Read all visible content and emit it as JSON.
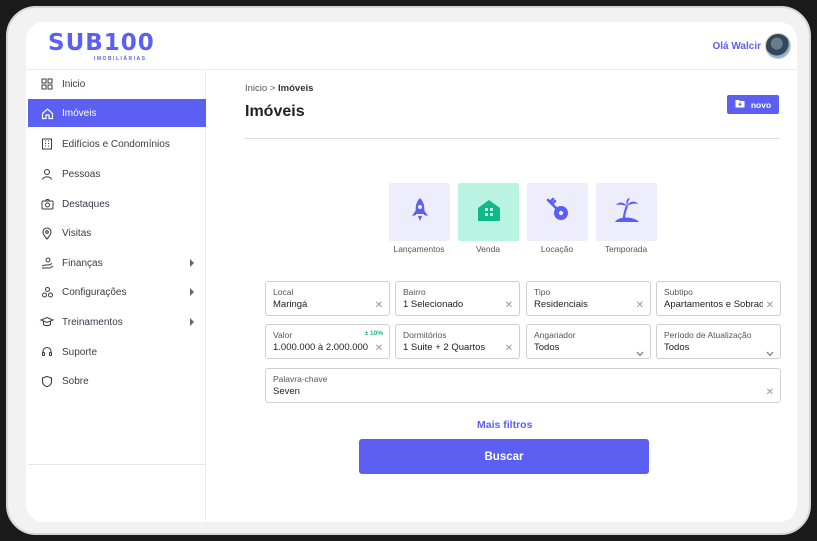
{
  "header": {
    "logo_main": "SUB100",
    "logo_sub": "IMOBILIÁRIAS",
    "greeting": "Olá Walcir"
  },
  "sidebar": {
    "items": [
      {
        "label": "Inicio",
        "icon": "grid-icon",
        "active": false,
        "has_submenu": false
      },
      {
        "label": "Imóveis",
        "icon": "home-icon",
        "active": true,
        "has_submenu": false
      },
      {
        "label": "Edifícios e Condomínios",
        "icon": "building-icon",
        "active": false,
        "has_submenu": false
      },
      {
        "label": "Pessoas",
        "icon": "person-icon",
        "active": false,
        "has_submenu": false
      },
      {
        "label": "Destaques",
        "icon": "camera-icon",
        "active": false,
        "has_submenu": false
      },
      {
        "label": "Visitas",
        "icon": "map-pin-icon",
        "active": false,
        "has_submenu": false
      },
      {
        "label": "Finanças",
        "icon": "money-hand-icon",
        "active": false,
        "has_submenu": true
      },
      {
        "label": "Configurações",
        "icon": "settings-icon",
        "active": false,
        "has_submenu": true
      },
      {
        "label": "Treinamentos",
        "icon": "training-icon",
        "active": false,
        "has_submenu": true
      },
      {
        "label": "Suporte",
        "icon": "support-icon",
        "active": false,
        "has_submenu": false
      },
      {
        "label": "Sobre",
        "icon": "shield-icon",
        "active": false,
        "has_submenu": false
      }
    ]
  },
  "main": {
    "breadcrumb_home": "Inicio",
    "breadcrumb_sep": ">",
    "breadcrumb_current": "Imóveis",
    "title": "Imóveis",
    "new_button": "novo",
    "categories": [
      {
        "label": "Lançamentos",
        "icon": "rocket-icon",
        "selected": false
      },
      {
        "label": "Venda",
        "icon": "house-icon",
        "selected": true
      },
      {
        "label": "Locação",
        "icon": "key-icon",
        "selected": false
      },
      {
        "label": "Temporada",
        "icon": "island-icon",
        "selected": false
      }
    ],
    "filters": {
      "local": {
        "label": "Local",
        "value": "Maringá"
      },
      "bairro": {
        "label": "Bairro",
        "value": "1 Selecionado"
      },
      "tipo": {
        "label": "Tipo",
        "value": "Residenciais"
      },
      "subtipo": {
        "label": "Subtipo",
        "value": "Apartamentos e Sobrados"
      },
      "valor": {
        "label": "Valor",
        "value": "1.000.000 à 2.000.000",
        "badge": "± 10%"
      },
      "dormitorios": {
        "label": "Dormitórios",
        "value": "1 Suite + 2 Quartos"
      },
      "angariador": {
        "label": "Angariador",
        "value": "Todos"
      },
      "periodo": {
        "label": "Período de Atualização",
        "value": "Todos"
      },
      "palavra": {
        "label": "Palavra-chave",
        "value": "Seven"
      }
    },
    "more_filters": "Mais filtros",
    "search_button": "Buscar"
  },
  "colors": {
    "accent": "#5b5ff2",
    "selected_category_bg": "#b9f3e2",
    "category_bg": "#ededfc",
    "badge_green": "#17b88f"
  }
}
